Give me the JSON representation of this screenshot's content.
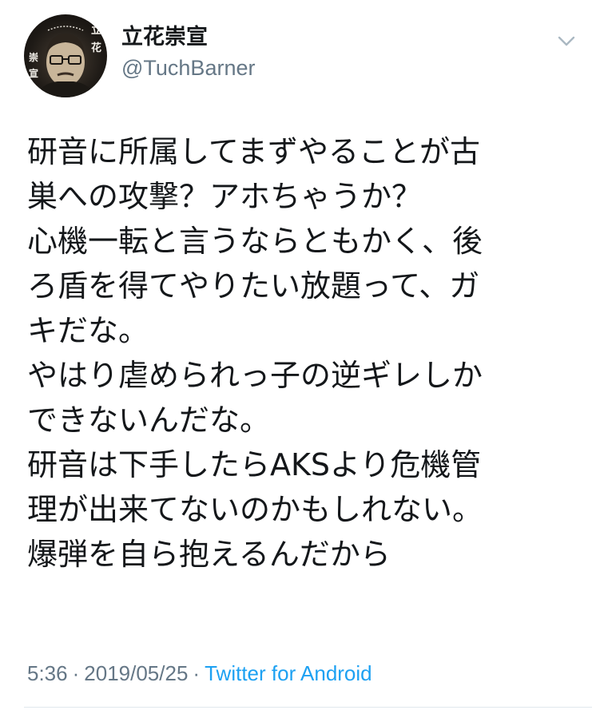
{
  "user": {
    "display_name": "立花崇宣",
    "handle": "@TuchBarner",
    "avatar_text": [
      "立",
      "花",
      "崇",
      "宣"
    ]
  },
  "tweet": {
    "lines": [
      "研音に所属してまずやることが古",
      "巣への攻撃？アホちゃうか？",
      " 心機一転と言うならともかく、後",
      "ろ盾を得てやりたい放題って、ガ",
      "キだな。",
      " やはり虐められっ子の逆ギレしか",
      "できないんだな。",
      " 研音は下手したらAKSより危機管",
      "理が出来てないのかもしれない。",
      "爆弾を自ら抱えるんだから"
    ],
    "time": "5:36",
    "date": "2019/05/25",
    "separator": "·",
    "source": "Twitter for Android"
  },
  "colors": {
    "text": "#14171a",
    "secondary": "#657786",
    "link": "#1da1f2",
    "divider": "#e1e8ed"
  },
  "icons": {
    "menu": "chevron-down-icon"
  }
}
